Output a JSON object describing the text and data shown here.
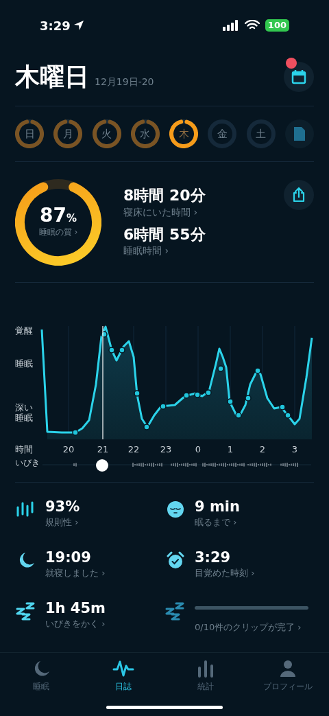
{
  "status_bar": {
    "time": "3:29",
    "battery": "100"
  },
  "header": {
    "title": "木曜日",
    "date": "12月19日-20",
    "calendar_badge": true
  },
  "days": [
    {
      "label": "日",
      "recorded": true,
      "selected": false
    },
    {
      "label": "月",
      "recorded": true,
      "selected": false
    },
    {
      "label": "火",
      "recorded": true,
      "selected": false
    },
    {
      "label": "水",
      "recorded": true,
      "selected": false
    },
    {
      "label": "木",
      "recorded": true,
      "selected": true
    },
    {
      "label": "金",
      "recorded": false,
      "selected": false
    },
    {
      "label": "土",
      "recorded": false,
      "selected": false
    }
  ],
  "summary": {
    "quality": {
      "value": "87",
      "unit": "%",
      "label": "睡眠の質 ›"
    },
    "items": [
      {
        "value": "8時間 20分",
        "label": "寝床にいた時間 ›"
      },
      {
        "value": "6時間 55分",
        "label": "睡眠時間 ›"
      }
    ]
  },
  "graph": {
    "y_labels": [
      "覚醒",
      "睡眠",
      "深い睡眠"
    ],
    "x_title": "時間",
    "hours": [
      "20",
      "21",
      "22",
      "23",
      "0",
      "1",
      "2",
      "3"
    ],
    "snore_label": "いびき"
  },
  "stats": [
    {
      "kind": "regularity",
      "value": "93%",
      "label": "規則性 ›"
    },
    {
      "kind": "fall_asleep",
      "value": "9 min",
      "label": "眠るまで ›"
    },
    {
      "kind": "bedtime",
      "value": "19:09",
      "label": "就寝しました ›"
    },
    {
      "kind": "wake",
      "value": "3:29",
      "label": "目覚めた時刻 ›"
    },
    {
      "kind": "snore",
      "value": "1h 45m",
      "label": "いびきをかく ›"
    },
    {
      "kind": "clips",
      "level": 0,
      "label": "0/10件のクリップが完了 ›"
    }
  ],
  "nav": [
    {
      "label": "睡眠",
      "selected": false
    },
    {
      "label": "日誌",
      "selected": true
    },
    {
      "label": "統計",
      "selected": false
    },
    {
      "label": "プロフィール",
      "selected": false
    }
  ]
}
